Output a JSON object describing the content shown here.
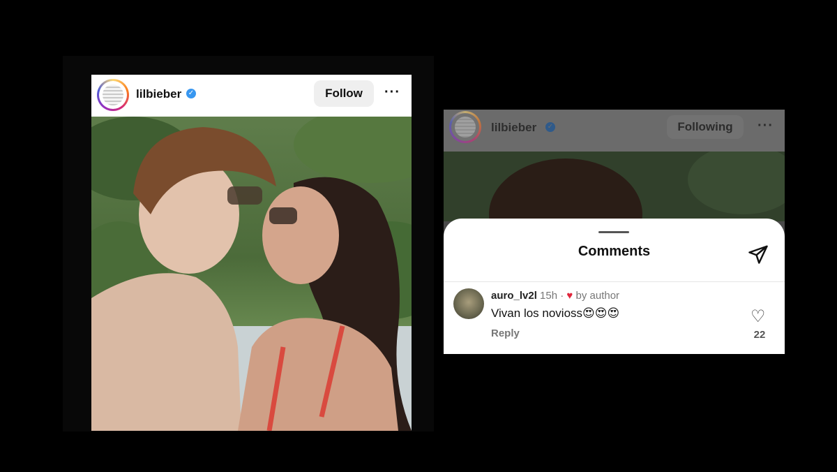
{
  "left_post": {
    "username": "lilbieber",
    "follow_label": "Follow",
    "more_label": "···"
  },
  "right_post": {
    "username": "lilbieber",
    "following_label": "Following",
    "more_label": "···",
    "comments_sheet": {
      "title": "Comments",
      "comment": {
        "username": "auro_lv2l",
        "time": "15h",
        "liked_by": "by author",
        "text": "Vivan los novioss😍😍😍",
        "reply_label": "Reply",
        "like_count": "22"
      }
    }
  },
  "icons": [
    "verified-badge-icon",
    "more-options-icon",
    "send-icon",
    "heart-icon"
  ],
  "colors": {
    "verified": "#3897f0",
    "liked_heart": "#e0263c"
  }
}
